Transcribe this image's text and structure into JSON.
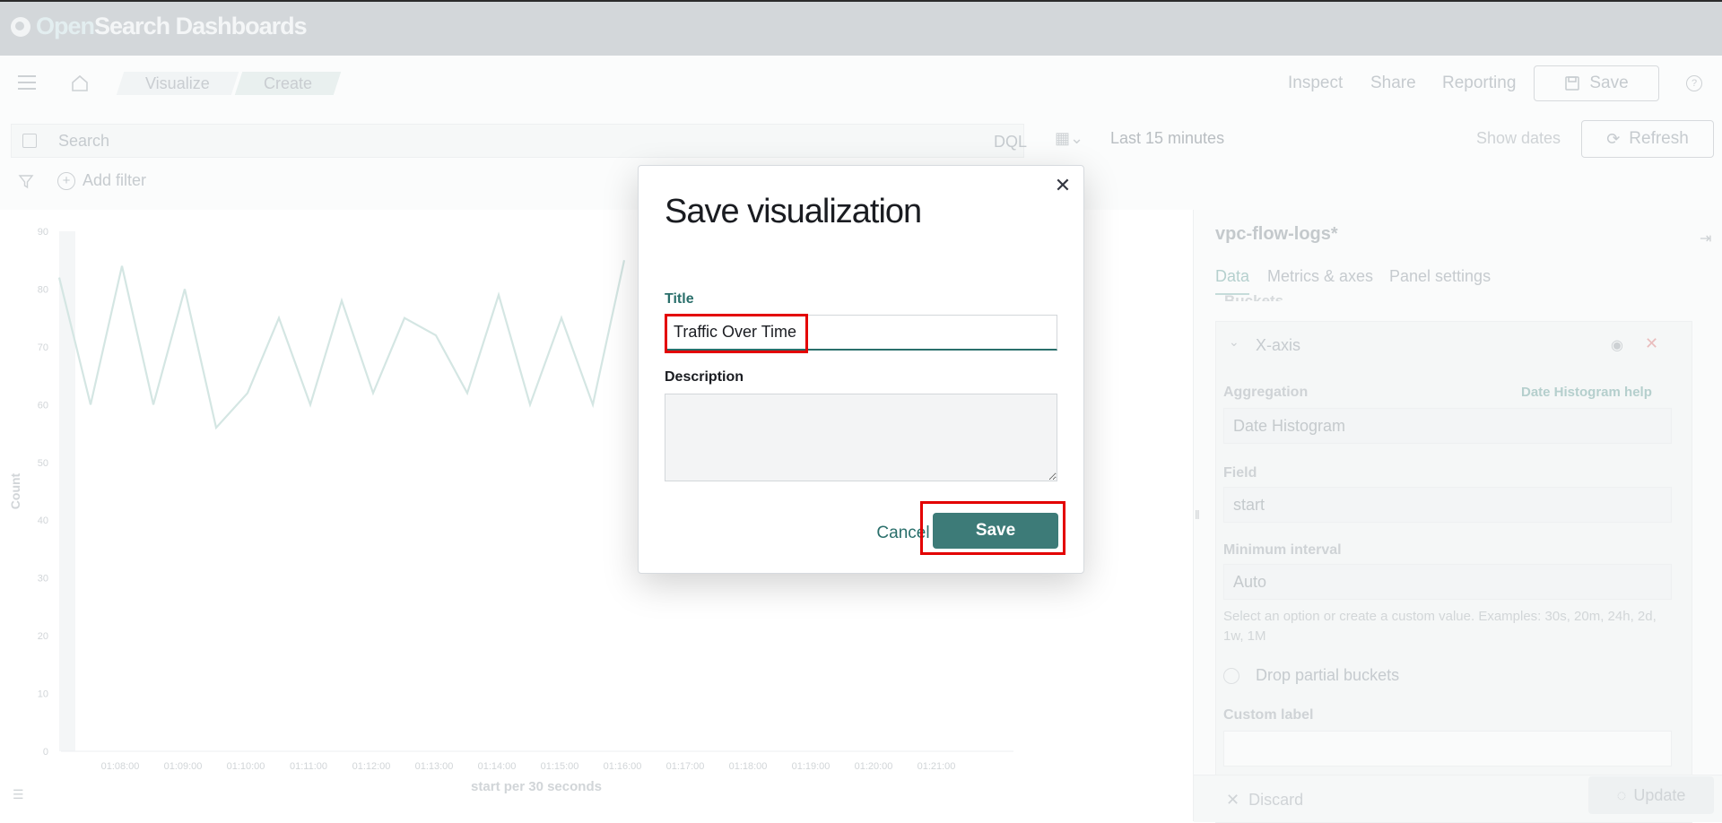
{
  "brand": {
    "open": "Open",
    "rest": "Search Dashboards"
  },
  "breadcrumbs": [
    "Visualize",
    "Create"
  ],
  "nav": {
    "inspect": "Inspect",
    "share": "Share",
    "reporting": "Reporting",
    "save": "Save"
  },
  "query": {
    "placeholder": "Search",
    "language": "DQL",
    "time_range": "Last 15 minutes",
    "show_dates": "Show dates",
    "refresh": "Refresh",
    "add_filter": "Add filter"
  },
  "chart_data": {
    "type": "line",
    "xlabel": "start per 30 seconds",
    "ylabel": "Count",
    "ylim": [
      0,
      90
    ],
    "y_ticks": [
      0,
      10,
      20,
      30,
      40,
      50,
      60,
      70,
      80,
      90
    ],
    "x_ticks": [
      "01:08:00",
      "01:09:00",
      "01:10:00",
      "01:11:00",
      "01:12:00",
      "01:13:00",
      "01:14:00",
      "01:15:00",
      "01:16:00",
      "01:17:00",
      "01:18:00",
      "01:19:00",
      "01:20:00",
      "01:21:00"
    ],
    "series": [
      {
        "values": [
          82,
          60,
          84,
          60,
          80,
          56,
          62,
          75,
          60,
          78,
          62,
          75,
          72,
          62,
          79,
          60,
          75,
          60,
          85
        ]
      }
    ],
    "grid": false
  },
  "sidebar": {
    "index_pattern": "vpc-flow-logs*",
    "tabs": [
      "Data",
      "Metrics & axes",
      "Panel settings"
    ],
    "section": "Buckets",
    "bucket_title": "X-axis",
    "aggregation_label": "Aggregation",
    "aggregation_help": "Date Histogram help",
    "aggregation_value": "Date Histogram",
    "field_label": "Field",
    "field_value": "start",
    "interval_label": "Minimum interval",
    "interval_value": "Auto",
    "interval_help": "Select an option or create a custom value. Examples: 30s, 20m, 24h, 2d, 1w, 1M",
    "drop_partial": "Drop partial buckets",
    "custom_label": "Custom label",
    "discard": "Discard",
    "update": "Update"
  },
  "modal": {
    "title": "Save visualization",
    "title_label": "Title",
    "title_value": "Traffic Over Time",
    "description_label": "Description",
    "description_value": "",
    "cancel": "Cancel",
    "save": "Save",
    "accent": "#3d7b78"
  }
}
